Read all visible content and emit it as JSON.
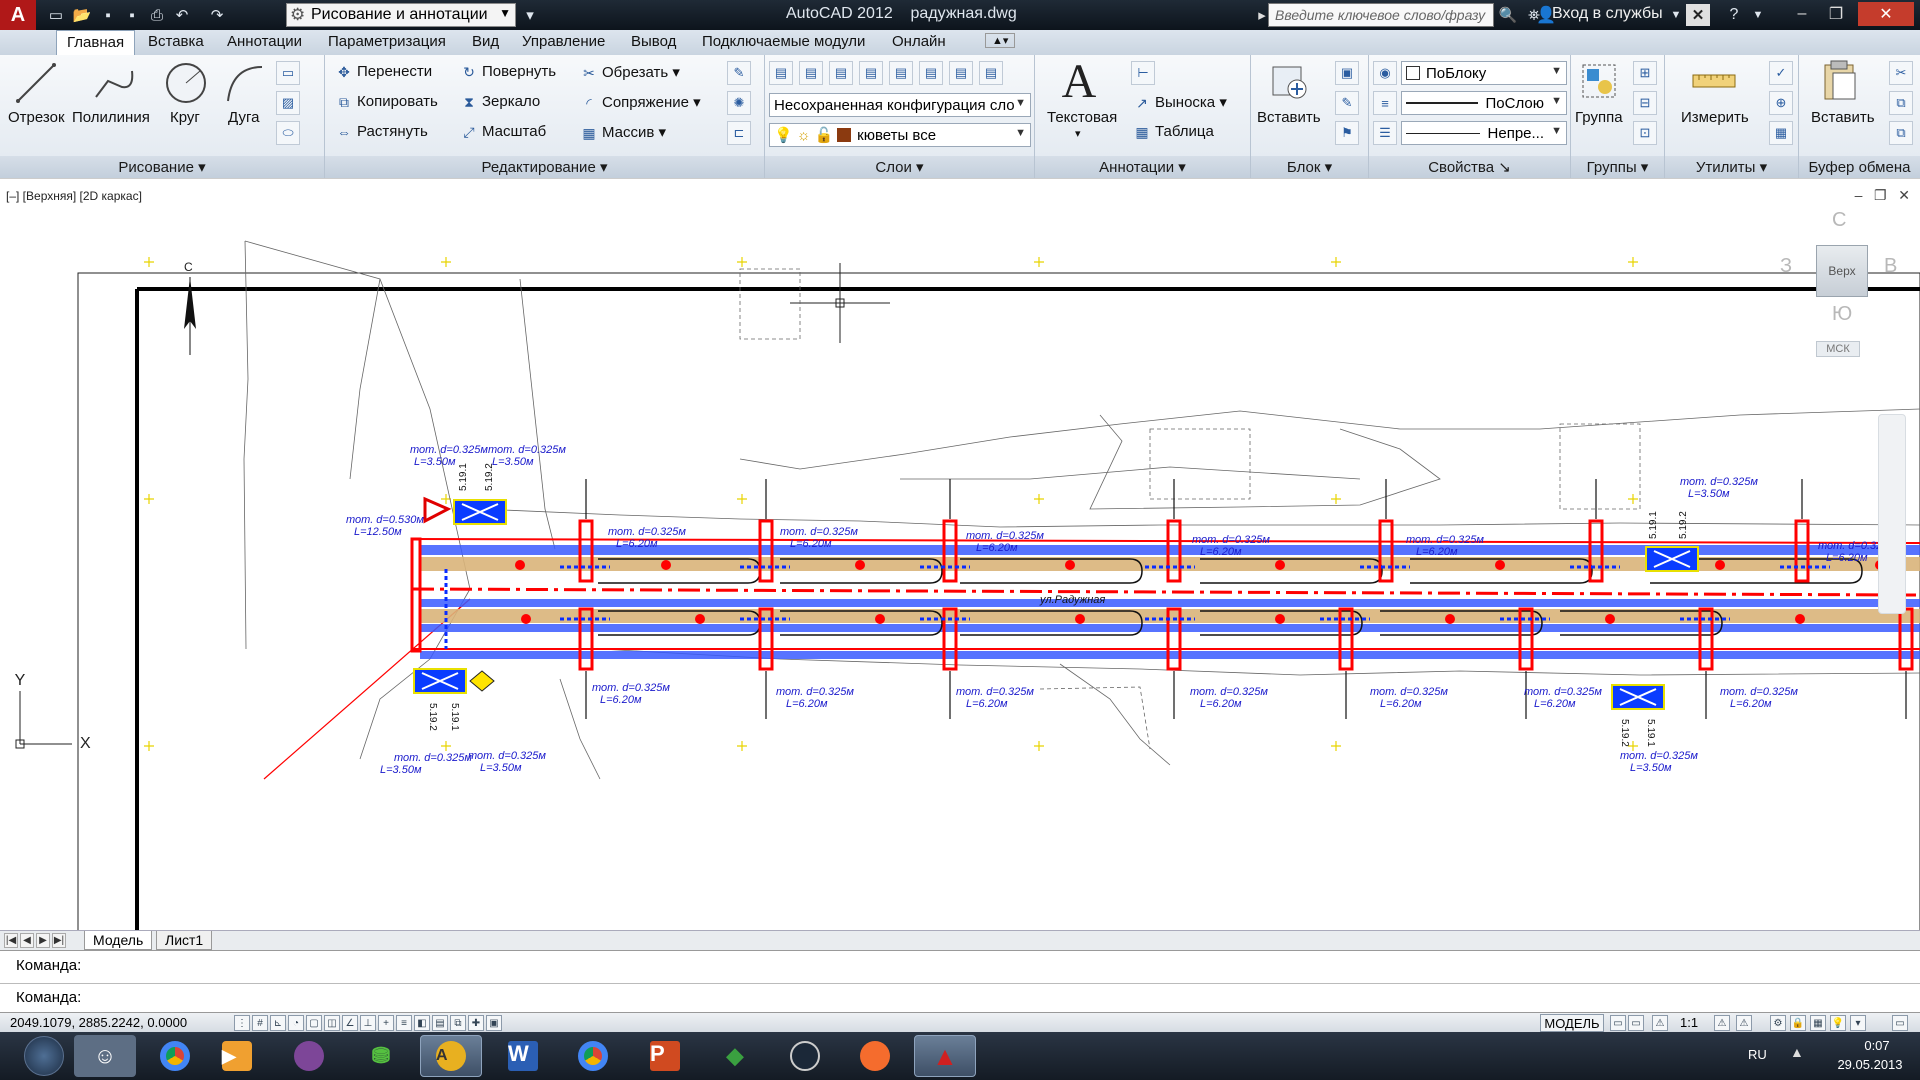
{
  "titlebar": {
    "workspace": "Рисование и аннотации",
    "app_name": "AutoCAD 2012",
    "file_name": "радужная.dwg",
    "search_placeholder": "Введите ключевое слово/фразу",
    "login_label": "Вход в службы"
  },
  "ribbon_tabs": [
    "Главная",
    "Вставка",
    "Аннотации",
    "Параметризация",
    "Вид",
    "Управление",
    "Вывод",
    "Подключаемые модули",
    "Онлайн"
  ],
  "panels": {
    "draw": {
      "title": "Рисование",
      "tools": [
        "Отрезок",
        "Полилиния",
        "Круг",
        "Дуга"
      ]
    },
    "modify": {
      "title": "Редактирование",
      "tools": [
        "Перенести",
        "Повернуть",
        "Обрезать",
        "Копировать",
        "Зеркало",
        "Сопряжение",
        "Растянуть",
        "Масштаб",
        "Массив"
      ]
    },
    "layers": {
      "title": "Слои",
      "layer_state": "Несохраненная конфигурация сло",
      "current_layer": "кюветы все"
    },
    "annotation": {
      "title": "Аннотации",
      "text_label": "Текстовая",
      "leader_label": "Выноска",
      "table_label": "Таблица"
    },
    "block": {
      "title": "Блок",
      "insert_label": "Вставить"
    },
    "properties": {
      "title": "Свойства",
      "color": "ПоБлоку",
      "lineweight": "ПоСлою",
      "linetype": "Непре..."
    },
    "groups": {
      "title": "Группы",
      "group_label": "Группа"
    },
    "utilities": {
      "title": "Утилиты",
      "measure_label": "Измерить"
    },
    "clipboard": {
      "title": "Буфер обмена",
      "paste_label": "Вставить"
    }
  },
  "viewport": {
    "label": "[–] [Верхняя] [2D каркас]",
    "viewcube": {
      "north": "С",
      "south": "Ю",
      "west": "З",
      "east": "В",
      "top": "Верх",
      "ucs": "МСК"
    },
    "north_arrow": "С",
    "street_name": "ул.Радужная",
    "drawing_texts": {
      "pipe_d325": "тот. d=0.325м",
      "len_620": "L=6.20м",
      "len_350": "L=3.50м",
      "pipe_d530": "тот. d=0.530м",
      "len_1250": "L=12.50м",
      "sign_a": "5.19.1",
      "sign_b": "5.19.2"
    }
  },
  "layout_tabs": [
    "Модель",
    "Лист1"
  ],
  "command": {
    "line1": "Команда:",
    "line2": "Команда:"
  },
  "status": {
    "coords": "2049.1079, 2885.2242, 0.0000",
    "model": "МОДЕЛЬ",
    "scale": "1:1"
  },
  "taskbar": {
    "lang": "RU",
    "time": "0:07",
    "date": "29.05.2013"
  },
  "colors": {
    "titlebar": "#1a2430",
    "ribbon": "#e8eef4",
    "road_red": "#ff0000",
    "ditch_blue": "#1a3cff",
    "annotation_blue": "#1a1acc"
  }
}
